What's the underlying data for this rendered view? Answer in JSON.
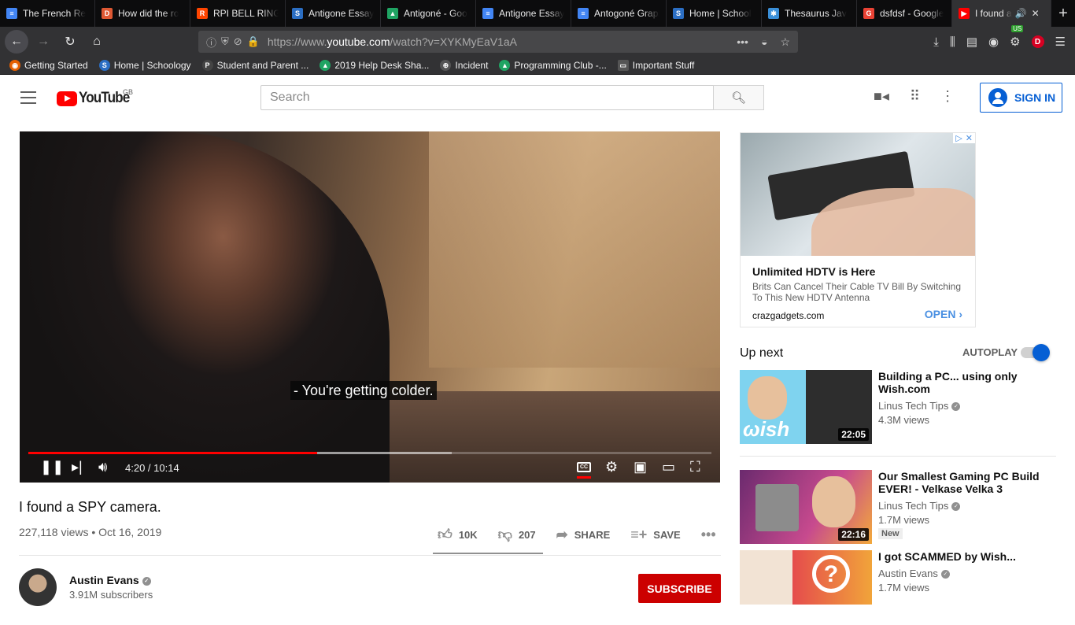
{
  "browser": {
    "tabs": [
      {
        "label": "The French Re",
        "color": "#4285f4",
        "glyph": "≡"
      },
      {
        "label": "How did the ro",
        "color": "#de5833",
        "glyph": "D"
      },
      {
        "label": "RPI BELL RINGI",
        "color": "#ff4500",
        "glyph": "R"
      },
      {
        "label": "Antigone Essay",
        "color": "#2b6ec3",
        "glyph": "S"
      },
      {
        "label": "Antigoné - Goo",
        "color": "#1fa463",
        "glyph": "▲"
      },
      {
        "label": "Antigone Essay",
        "color": "#4285f4",
        "glyph": "≡"
      },
      {
        "label": "Antogoné Graph",
        "color": "#4285f4",
        "glyph": "≡"
      },
      {
        "label": "Home | School",
        "color": "#2b6ec3",
        "glyph": "S"
      },
      {
        "label": "Thesaurus Jav",
        "color": "#3a8fd8",
        "glyph": "✱"
      },
      {
        "label": "dsfdsf - Google",
        "color": "#ea4335",
        "glyph": "G"
      }
    ],
    "active_tab": {
      "label": "I found a",
      "color": "#ff0000"
    },
    "url": {
      "scheme": "https://www.",
      "host": "youtube.com",
      "path": "/watch?v=XYKMyEaV1aA"
    },
    "badge": "US",
    "avatar_letter": "D",
    "bookmarks": [
      {
        "label": "Getting Started",
        "color": "#e66000",
        "glyph": "◉"
      },
      {
        "label": "Home | Schoology",
        "color": "#2b6ec3",
        "glyph": "S"
      },
      {
        "label": "Student and Parent ...",
        "color": "#444",
        "glyph": "P"
      },
      {
        "label": "2019 Help Desk Sha...",
        "color": "#1fa463",
        "glyph": "▲"
      },
      {
        "label": "Incident",
        "color": "#555",
        "glyph": "⊕"
      },
      {
        "label": "Programming Club -...",
        "color": "#1fa463",
        "glyph": "▲"
      },
      {
        "label": "Important Stuff",
        "color": "#555",
        "glyph": "▭"
      }
    ]
  },
  "youtube": {
    "logo": "YouTube",
    "region": "GB",
    "search_placeholder": "Search",
    "signin": "SIGN IN"
  },
  "video": {
    "caption": "- You're getting colder.",
    "current_time": "4:20",
    "duration": "10:14",
    "time_display": "4:20 / 10:14",
    "played_fraction": 0.423,
    "buffered_fraction": 0.62,
    "title": "I found a SPY camera.",
    "meta": "227,118 views • Oct 16, 2019",
    "likes": "10K",
    "dislikes": "207",
    "share": "SHARE",
    "save": "SAVE",
    "channel": "Austin Evans",
    "subscribers": "3.91M subscribers",
    "subscribe": "SUBSCRIBE"
  },
  "ad": {
    "headline": "Unlimited HDTV is Here",
    "description": "Brits Can Cancel Their Cable TV Bill By Switching To This New HDTV Antenna",
    "domain": "crazgadgets.com",
    "cta": "OPEN"
  },
  "sidebar": {
    "up_next": "Up next",
    "autoplay": "AUTOPLAY",
    "autoplay_on": true,
    "recommendations": [
      {
        "title": "Building a PC... using only Wish.com",
        "channel": "Linus Tech Tips",
        "views": "4.3M views",
        "duration": "22:05",
        "badge": ""
      },
      {
        "title": "Our Smallest Gaming PC Build EVER! - Velkase Velka 3",
        "channel": "Linus Tech Tips",
        "views": "1.7M views",
        "duration": "22:16",
        "badge": "New"
      },
      {
        "title": "I got SCAMMED by Wish...",
        "channel": "Austin Evans",
        "views": "1.7M views",
        "duration": "",
        "badge": ""
      }
    ]
  }
}
